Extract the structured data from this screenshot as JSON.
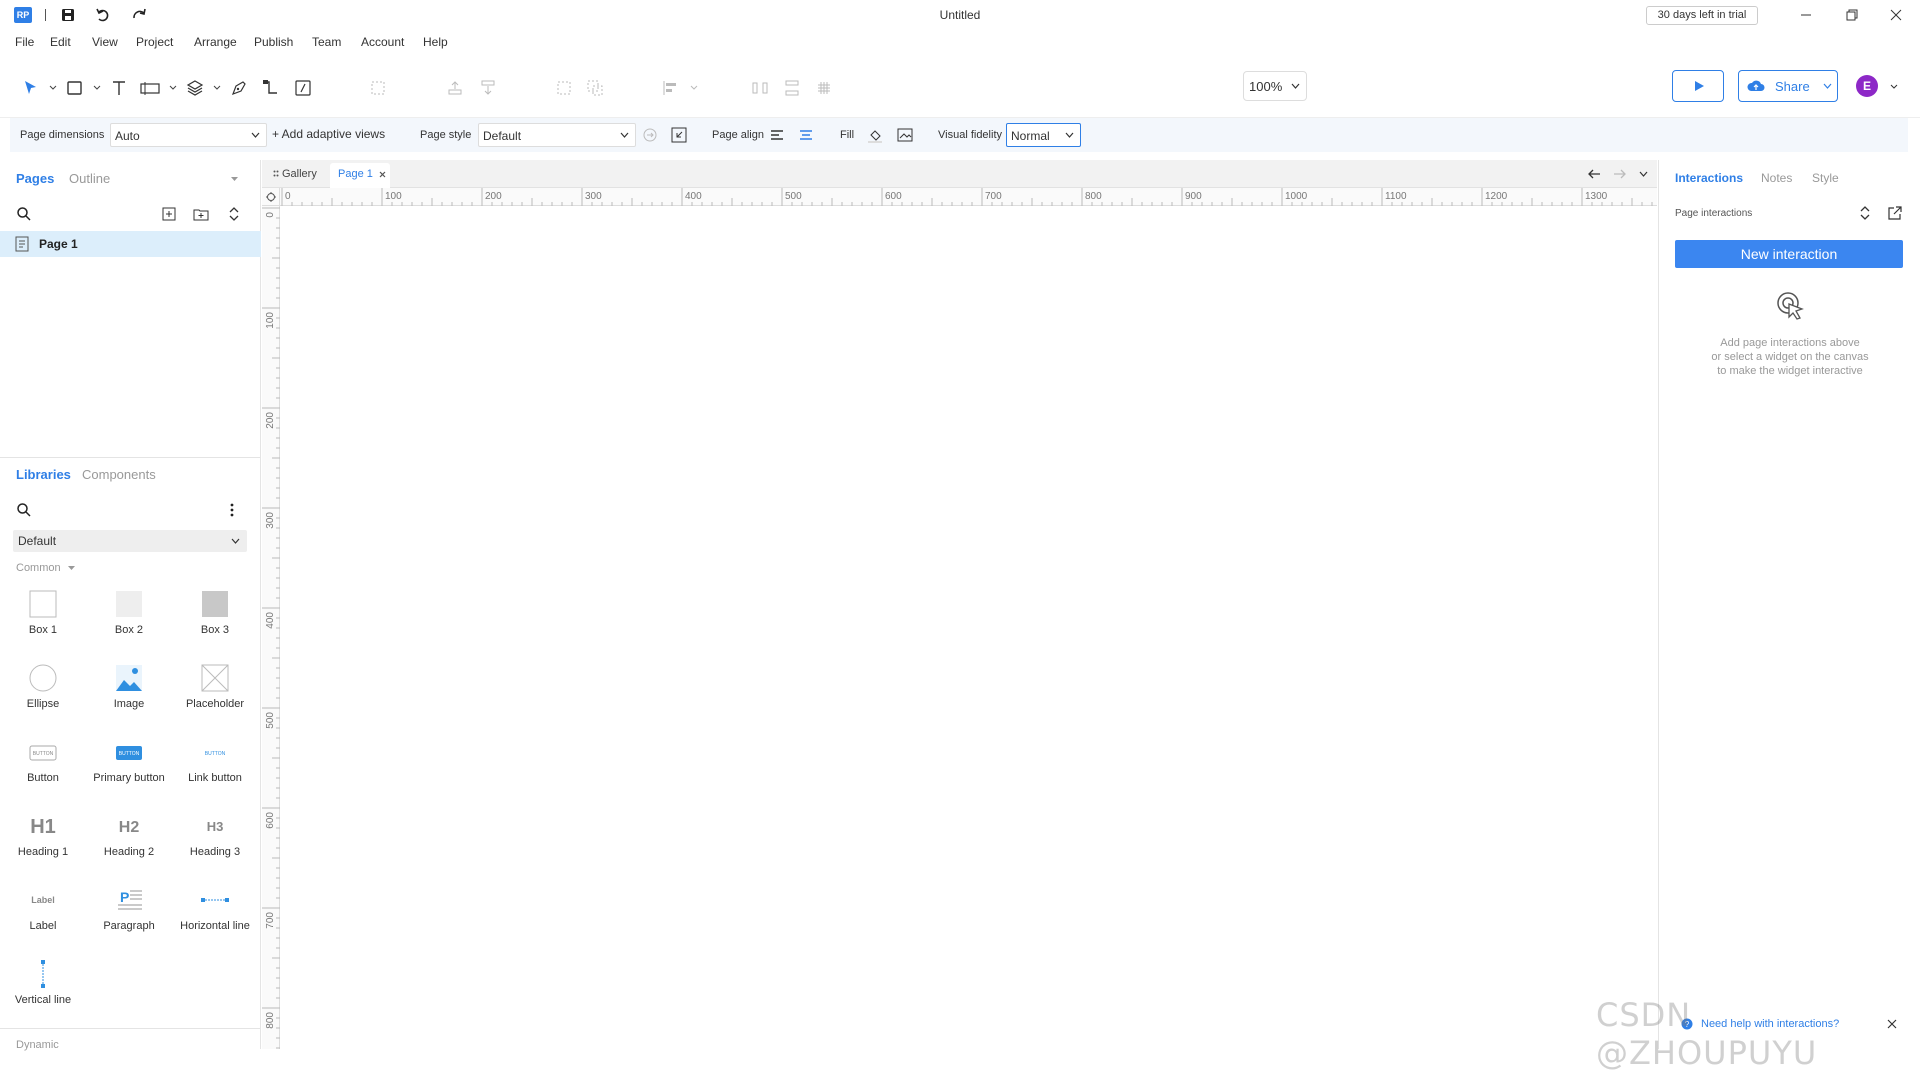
{
  "window": {
    "title": "Untitled",
    "trial": "30 days left in trial",
    "logo": "RP"
  },
  "menu": [
    "File",
    "Edit",
    "View",
    "Project",
    "Arrange",
    "Publish",
    "Team",
    "Account",
    "Help"
  ],
  "toolbar": {
    "zoom": "100%",
    "share_label": "Share",
    "avatar_letter": "E"
  },
  "stylebar": {
    "page_dimensions_label": "Page dimensions",
    "page_dimensions_value": "Auto",
    "add_adaptive": "+ Add adaptive views",
    "page_style_label": "Page style",
    "page_style_value": "Default",
    "page_align_label": "Page align",
    "fill_label": "Fill",
    "visual_fidelity_label": "Visual fidelity",
    "visual_fidelity_value": "Normal"
  },
  "left": {
    "tabs": [
      "Pages",
      "Outline"
    ],
    "pages": [
      {
        "label": "Page 1"
      }
    ],
    "lib_tabs": [
      "Libraries",
      "Components"
    ],
    "library_select": "Default",
    "section_common": "Common",
    "section_dynamic": "Dynamic",
    "items": [
      "Box 1",
      "Box 2",
      "Box 3",
      "Ellipse",
      "Image",
      "Placeholder",
      "Button",
      "Primary button",
      "Link button",
      "Heading 1",
      "Heading 2",
      "Heading 3",
      "Label",
      "Paragraph",
      "Horizontal line",
      "Vertical line"
    ],
    "icon_text": {
      "button": "BUTTON",
      "h1": "H1",
      "h2": "H2",
      "h3": "H3",
      "label": "Label",
      "paragraph": "P"
    }
  },
  "canvas": {
    "gallery_tab": "Gallery",
    "page_tab": "Page 1",
    "ruler_h": [
      "0",
      "100",
      "200",
      "300",
      "400",
      "500",
      "600",
      "700",
      "800",
      "900",
      "1000",
      "1100",
      "1200",
      "1300"
    ],
    "ruler_v": [
      "0",
      "100",
      "200",
      "300",
      "400",
      "500",
      "600",
      "700",
      "800"
    ]
  },
  "right": {
    "tabs": [
      "Interactions",
      "Notes",
      "Style"
    ],
    "page_interactions": "Page interactions",
    "new_interaction": "New interaction",
    "hint_lines": [
      "Add page interactions above",
      "or select a widget on the canvas",
      "to make the widget interactive"
    ],
    "help_link": "Need help with interactions?"
  },
  "watermark": "CSDN @ZHOUPUYU",
  "colors": {
    "accent": "#2f7fe6",
    "button_blue": "#3b86f0",
    "avatar": "#8d28c7",
    "selected_row": "#dceefb"
  }
}
